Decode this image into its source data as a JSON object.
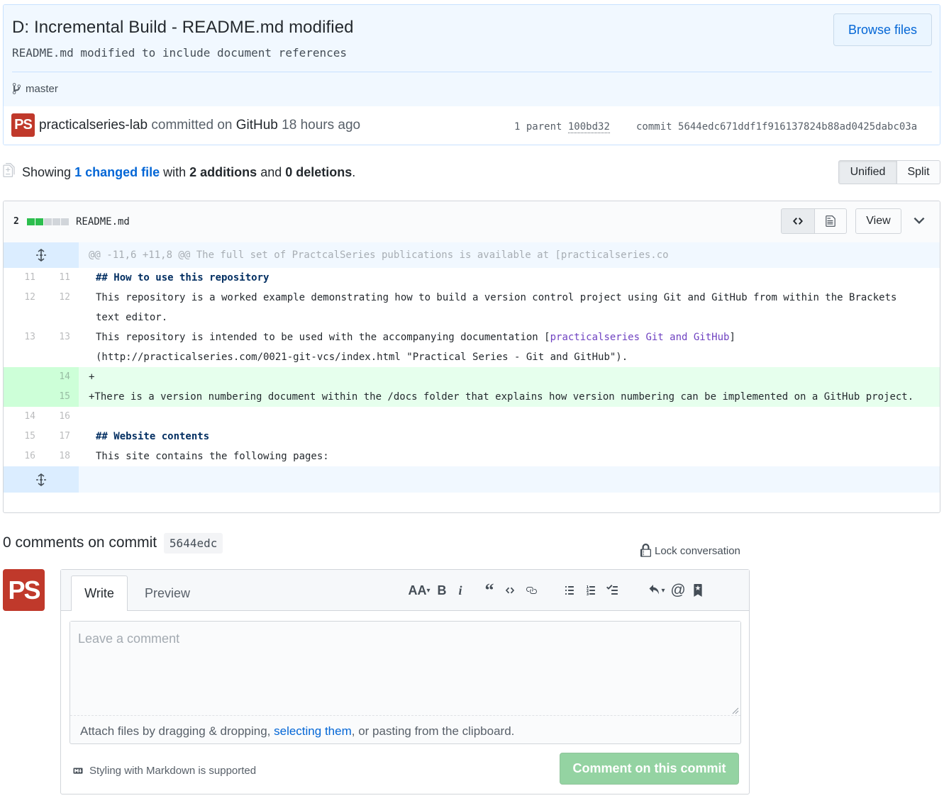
{
  "commit": {
    "title": "D: Incremental Build - README.md modified",
    "description": "README.md modified to include document references",
    "browse_files": "Browse files",
    "branch": "master",
    "avatar_text": "PS",
    "author": "practicalseries-lab",
    "committed_on": "committed on",
    "committer": "GitHub",
    "time": "18 hours ago",
    "parent_label": "1 parent",
    "parent_sha": "100bd32",
    "commit_label": "commit",
    "commit_sha": "5644edc671ddf1f916137824b88ad0425dabc03a"
  },
  "toc": {
    "showing": "Showing",
    "changed": "1 changed file",
    "with": "with",
    "additions": "2 additions",
    "and": "and",
    "deletions": "0 deletions",
    "period": ".",
    "unified": "Unified",
    "split": "Split"
  },
  "file": {
    "diffstat": "2",
    "name": "README.md",
    "view": "View",
    "hunk_header": "@@ -11,6 +11,8 @@ The full set of PractcalSeries publications is available at [practicalseries.co",
    "lines": [
      {
        "old": "11",
        "new": "11",
        "type": "ctx",
        "text": "## How to use this repository"
      },
      {
        "old": "12",
        "new": "12",
        "type": "ctx",
        "text": "This repository is a worked example demonstrating how to build a version control project using Git and GitHub from within the Brackets text editor."
      },
      {
        "old": "13",
        "new": "13",
        "type": "ctx",
        "text_a": "This repository is intended to be used with the accompanying documentation [",
        "link": "practicalseries Git and GitHub",
        "text_b": "](http://practicalseries.com/0021-git-vcs/index.html \"Practical Series - Git and GitHub\")."
      },
      {
        "old": "",
        "new": "14",
        "type": "add",
        "text": "+"
      },
      {
        "old": "",
        "new": "15",
        "type": "add",
        "text": "+There is a version numbering document within the /docs folder that explains how version numbering can be implemented on a GitHub project."
      },
      {
        "old": "14",
        "new": "16",
        "type": "ctx",
        "text": ""
      },
      {
        "old": "15",
        "new": "17",
        "type": "ctx",
        "text": "## Website contents"
      },
      {
        "old": "16",
        "new": "18",
        "type": "ctx",
        "text": "This site contains the following pages:"
      }
    ]
  },
  "comments": {
    "title": "0 comments on commit",
    "sha": "5644edc",
    "lock": "Lock conversation",
    "write_tab": "Write",
    "preview_tab": "Preview",
    "placeholder": "Leave a comment",
    "attach_a": "Attach files by dragging & dropping, ",
    "attach_link": "selecting them",
    "attach_b": ", or pasting from the clipboard.",
    "markdown_note": "Styling with Markdown is supported",
    "submit": "Comment on this commit",
    "toolbar_heading": "AA",
    "toolbar_bold": "B",
    "toolbar_italic": "i"
  }
}
